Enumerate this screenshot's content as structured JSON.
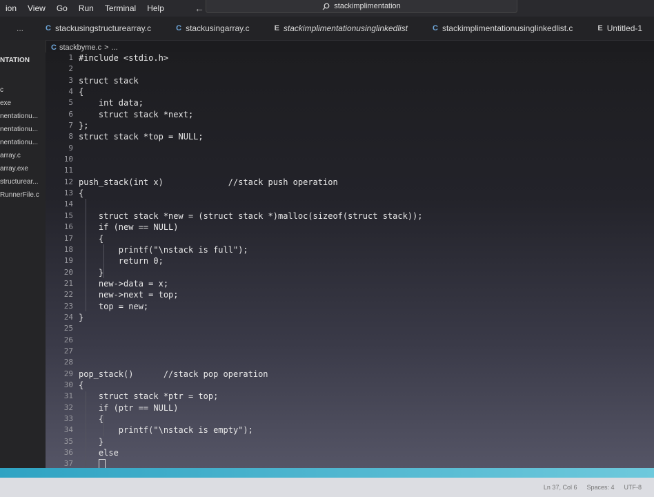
{
  "menubar": {
    "items": [
      "ion",
      "View",
      "Go",
      "Run",
      "Terminal",
      "Help"
    ],
    "back_icon": "arrow-left-icon",
    "forward_icon": "arrow-right-icon",
    "search_text": "stackimplimentation"
  },
  "tabs": {
    "more_label": "...",
    "items": [
      {
        "lang": "C",
        "label": "stackusingstructurearray.c"
      },
      {
        "lang": "C",
        "label": "stackusingarray.c"
      },
      {
        "lang": "E",
        "label": "stackimplimentationusinglinkedlist"
      },
      {
        "lang": "C",
        "label": "stackimplimentationusinglinkedlist.c"
      },
      {
        "lang": "E",
        "label": "Untitled-1"
      }
    ]
  },
  "sidebar": {
    "title": "NTATION",
    "items": [
      "c",
      "exe",
      "nentationu...",
      "nentationu...",
      "nentationu...",
      "array.c",
      "array.exe",
      "structurear...",
      "RunnerFile.c"
    ]
  },
  "breadcrumb": {
    "lang": "C",
    "file": "stackbyme.c",
    "sep": ">",
    "more": "..."
  },
  "editor": {
    "line_numbers": [
      "1",
      "2",
      "3",
      "4",
      "5",
      "6",
      "7",
      "8",
      "9",
      "10",
      "11",
      "12",
      "13",
      "14",
      "15",
      "16",
      "17",
      "18",
      "19",
      "20",
      "21",
      "22",
      "23",
      "24",
      "25",
      "26",
      "27",
      "28",
      "29",
      "30",
      "31",
      "32",
      "33",
      "34",
      "35",
      "36",
      "37"
    ],
    "lines": [
      "#include <stdio.h>",
      "",
      "struct stack",
      "{",
      "    int data;",
      "    struct stack *next;",
      "};",
      "struct stack *top = NULL;",
      "",
      "",
      "",
      "push_stack(int x)             //stack push operation",
      "{",
      "",
      "    struct stack *new = (struct stack *)malloc(sizeof(struct stack));",
      "    if (new == NULL)",
      "    {",
      "        printf(\"\\nstack is full\");",
      "        return 0;",
      "    }",
      "    new->data = x;",
      "    new->next = top;",
      "    top = new;",
      "}",
      "",
      "",
      "",
      "",
      "pop_stack()      //stack pop operation",
      "{",
      "    struct stack *ptr = top;",
      "    if (ptr == NULL)",
      "    {",
      "        printf(\"\\nstack is empty\");",
      "    }",
      "    else",
      "    "
    ]
  },
  "status": {
    "position": "Ln 37, Col 6",
    "spaces": "Spaces: 4",
    "encoding": "UTF-8"
  },
  "colors": {
    "accent": "#2fa3c3",
    "c_icon": "#6fa8dc"
  }
}
